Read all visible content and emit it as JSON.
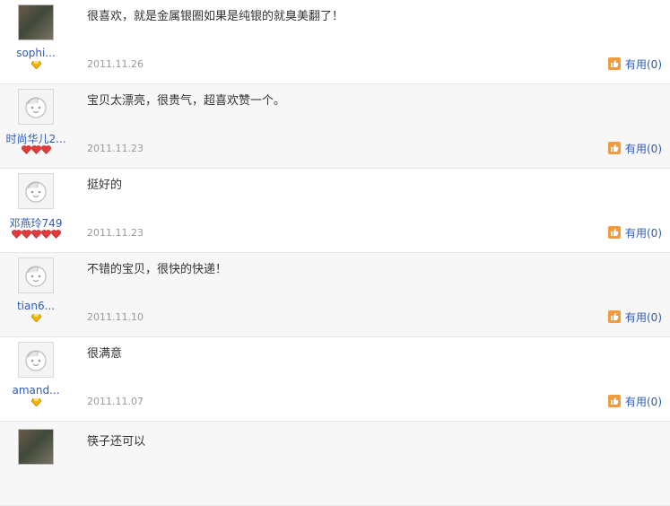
{
  "reviews": [
    {
      "user": "sophi...",
      "avatar": "photo-avatar",
      "level": "diamond",
      "level_count": 1,
      "text": "很喜欢，就是金属银圈如果是纯银的就臭美翻了！",
      "date": "2011.11.26",
      "useful": "有用(0)"
    },
    {
      "user": "时尚华儿2...",
      "avatar": "default-face-icon",
      "level": "heart",
      "level_count": 3,
      "text": "宝贝太漂亮，很贵气，超喜欢赞一个。",
      "date": "2011.11.23",
      "useful": "有用(0)"
    },
    {
      "user": "邓燕玲749",
      "avatar": "default-face-icon",
      "level": "heart",
      "level_count": 5,
      "text": "挺好的",
      "date": "2011.11.23",
      "useful": "有用(0)"
    },
    {
      "user": "tian6...",
      "avatar": "default-face-icon",
      "level": "diamond",
      "level_count": 1,
      "text": "不错的宝贝，很快的快递！",
      "date": "2011.11.10",
      "useful": "有用(0)"
    },
    {
      "user": "amand...",
      "avatar": "default-face-icon",
      "level": "diamond",
      "level_count": 1,
      "text": "很满意",
      "date": "2011.11.07",
      "useful": "有用(0)"
    },
    {
      "user": "",
      "avatar": "photo-avatar",
      "level": "",
      "level_count": 0,
      "text": "筷子还可以",
      "date": "",
      "useful": ""
    }
  ],
  "colors": {
    "link": "#2e5bb8",
    "date": "#999999",
    "thumb": "#f39a3c",
    "heart": "#e23b3b",
    "diamond": "#f2b400",
    "alt_row": "#f7f7f7"
  }
}
